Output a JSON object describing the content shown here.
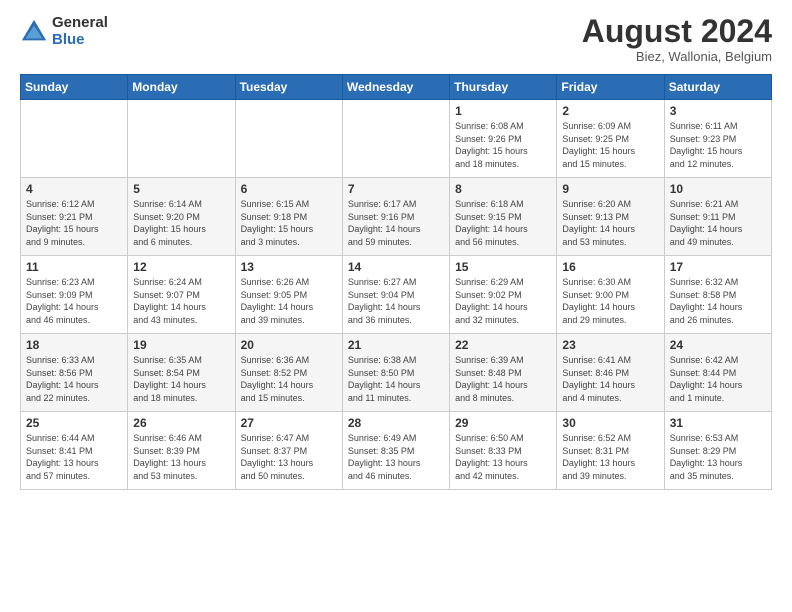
{
  "logo": {
    "general": "General",
    "blue": "Blue"
  },
  "title": "August 2024",
  "subtitle": "Biez, Wallonia, Belgium",
  "days_header": [
    "Sunday",
    "Monday",
    "Tuesday",
    "Wednesday",
    "Thursday",
    "Friday",
    "Saturday"
  ],
  "weeks": [
    [
      {
        "day": "",
        "info": ""
      },
      {
        "day": "",
        "info": ""
      },
      {
        "day": "",
        "info": ""
      },
      {
        "day": "",
        "info": ""
      },
      {
        "day": "1",
        "info": "Sunrise: 6:08 AM\nSunset: 9:26 PM\nDaylight: 15 hours\nand 18 minutes."
      },
      {
        "day": "2",
        "info": "Sunrise: 6:09 AM\nSunset: 9:25 PM\nDaylight: 15 hours\nand 15 minutes."
      },
      {
        "day": "3",
        "info": "Sunrise: 6:11 AM\nSunset: 9:23 PM\nDaylight: 15 hours\nand 12 minutes."
      }
    ],
    [
      {
        "day": "4",
        "info": "Sunrise: 6:12 AM\nSunset: 9:21 PM\nDaylight: 15 hours\nand 9 minutes."
      },
      {
        "day": "5",
        "info": "Sunrise: 6:14 AM\nSunset: 9:20 PM\nDaylight: 15 hours\nand 6 minutes."
      },
      {
        "day": "6",
        "info": "Sunrise: 6:15 AM\nSunset: 9:18 PM\nDaylight: 15 hours\nand 3 minutes."
      },
      {
        "day": "7",
        "info": "Sunrise: 6:17 AM\nSunset: 9:16 PM\nDaylight: 14 hours\nand 59 minutes."
      },
      {
        "day": "8",
        "info": "Sunrise: 6:18 AM\nSunset: 9:15 PM\nDaylight: 14 hours\nand 56 minutes."
      },
      {
        "day": "9",
        "info": "Sunrise: 6:20 AM\nSunset: 9:13 PM\nDaylight: 14 hours\nand 53 minutes."
      },
      {
        "day": "10",
        "info": "Sunrise: 6:21 AM\nSunset: 9:11 PM\nDaylight: 14 hours\nand 49 minutes."
      }
    ],
    [
      {
        "day": "11",
        "info": "Sunrise: 6:23 AM\nSunset: 9:09 PM\nDaylight: 14 hours\nand 46 minutes."
      },
      {
        "day": "12",
        "info": "Sunrise: 6:24 AM\nSunset: 9:07 PM\nDaylight: 14 hours\nand 43 minutes."
      },
      {
        "day": "13",
        "info": "Sunrise: 6:26 AM\nSunset: 9:05 PM\nDaylight: 14 hours\nand 39 minutes."
      },
      {
        "day": "14",
        "info": "Sunrise: 6:27 AM\nSunset: 9:04 PM\nDaylight: 14 hours\nand 36 minutes."
      },
      {
        "day": "15",
        "info": "Sunrise: 6:29 AM\nSunset: 9:02 PM\nDaylight: 14 hours\nand 32 minutes."
      },
      {
        "day": "16",
        "info": "Sunrise: 6:30 AM\nSunset: 9:00 PM\nDaylight: 14 hours\nand 29 minutes."
      },
      {
        "day": "17",
        "info": "Sunrise: 6:32 AM\nSunset: 8:58 PM\nDaylight: 14 hours\nand 26 minutes."
      }
    ],
    [
      {
        "day": "18",
        "info": "Sunrise: 6:33 AM\nSunset: 8:56 PM\nDaylight: 14 hours\nand 22 minutes."
      },
      {
        "day": "19",
        "info": "Sunrise: 6:35 AM\nSunset: 8:54 PM\nDaylight: 14 hours\nand 18 minutes."
      },
      {
        "day": "20",
        "info": "Sunrise: 6:36 AM\nSunset: 8:52 PM\nDaylight: 14 hours\nand 15 minutes."
      },
      {
        "day": "21",
        "info": "Sunrise: 6:38 AM\nSunset: 8:50 PM\nDaylight: 14 hours\nand 11 minutes."
      },
      {
        "day": "22",
        "info": "Sunrise: 6:39 AM\nSunset: 8:48 PM\nDaylight: 14 hours\nand 8 minutes."
      },
      {
        "day": "23",
        "info": "Sunrise: 6:41 AM\nSunset: 8:46 PM\nDaylight: 14 hours\nand 4 minutes."
      },
      {
        "day": "24",
        "info": "Sunrise: 6:42 AM\nSunset: 8:44 PM\nDaylight: 14 hours\nand 1 minute."
      }
    ],
    [
      {
        "day": "25",
        "info": "Sunrise: 6:44 AM\nSunset: 8:41 PM\nDaylight: 13 hours\nand 57 minutes."
      },
      {
        "day": "26",
        "info": "Sunrise: 6:46 AM\nSunset: 8:39 PM\nDaylight: 13 hours\nand 53 minutes."
      },
      {
        "day": "27",
        "info": "Sunrise: 6:47 AM\nSunset: 8:37 PM\nDaylight: 13 hours\nand 50 minutes."
      },
      {
        "day": "28",
        "info": "Sunrise: 6:49 AM\nSunset: 8:35 PM\nDaylight: 13 hours\nand 46 minutes."
      },
      {
        "day": "29",
        "info": "Sunrise: 6:50 AM\nSunset: 8:33 PM\nDaylight: 13 hours\nand 42 minutes."
      },
      {
        "day": "30",
        "info": "Sunrise: 6:52 AM\nSunset: 8:31 PM\nDaylight: 13 hours\nand 39 minutes."
      },
      {
        "day": "31",
        "info": "Sunrise: 6:53 AM\nSunset: 8:29 PM\nDaylight: 13 hours\nand 35 minutes."
      }
    ]
  ]
}
